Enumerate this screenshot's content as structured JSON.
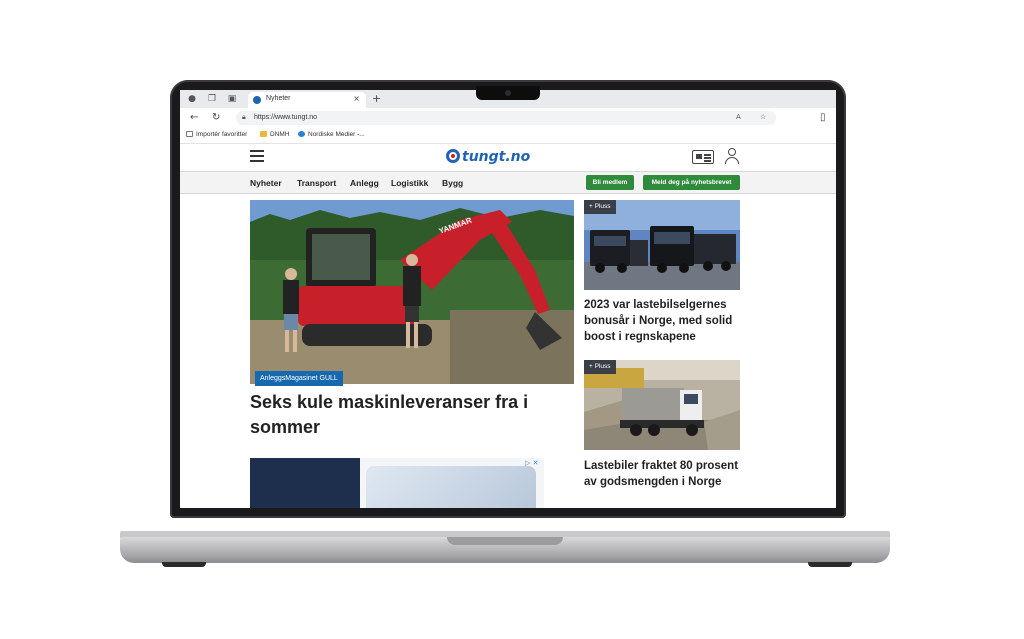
{
  "browser": {
    "tab_title": "Nyheter",
    "tab_close": "×",
    "new_tab": "+",
    "url": "https://www.tungt.no",
    "bookmarks": [
      "Importér favoritter",
      "DNMH",
      "Nordiske Medier -..."
    ]
  },
  "site": {
    "logo": "tungt.no",
    "nav": [
      "Nyheter",
      "Transport",
      "Anlegg",
      "Logistikk",
      "Bygg"
    ],
    "member_button": "Bli medlem",
    "newsletter_button": "Meld deg på nyhetsbrevet"
  },
  "hero": {
    "badge": "AnleggsMagasinet GULL",
    "title": "Seks kule maskinleveranser fra i sommer",
    "brand": "YANMAR"
  },
  "sidebar": {
    "articles": [
      {
        "badge": "+ Pluss",
        "title": "2023 var lastebilselgernes bonusår i Norge, med solid boost i regnskapene"
      },
      {
        "badge": "+ Pluss",
        "title": "Lastebiler fraktet 80 prosent av godsmengden i Norge"
      }
    ]
  },
  "ad": {
    "choice": "▷ ✕"
  },
  "colors": {
    "brand_blue": "#1f63b3",
    "brand_red": "#d21f2b",
    "cta_green": "#2f8a3c",
    "badge_blue": "#1769ad"
  }
}
